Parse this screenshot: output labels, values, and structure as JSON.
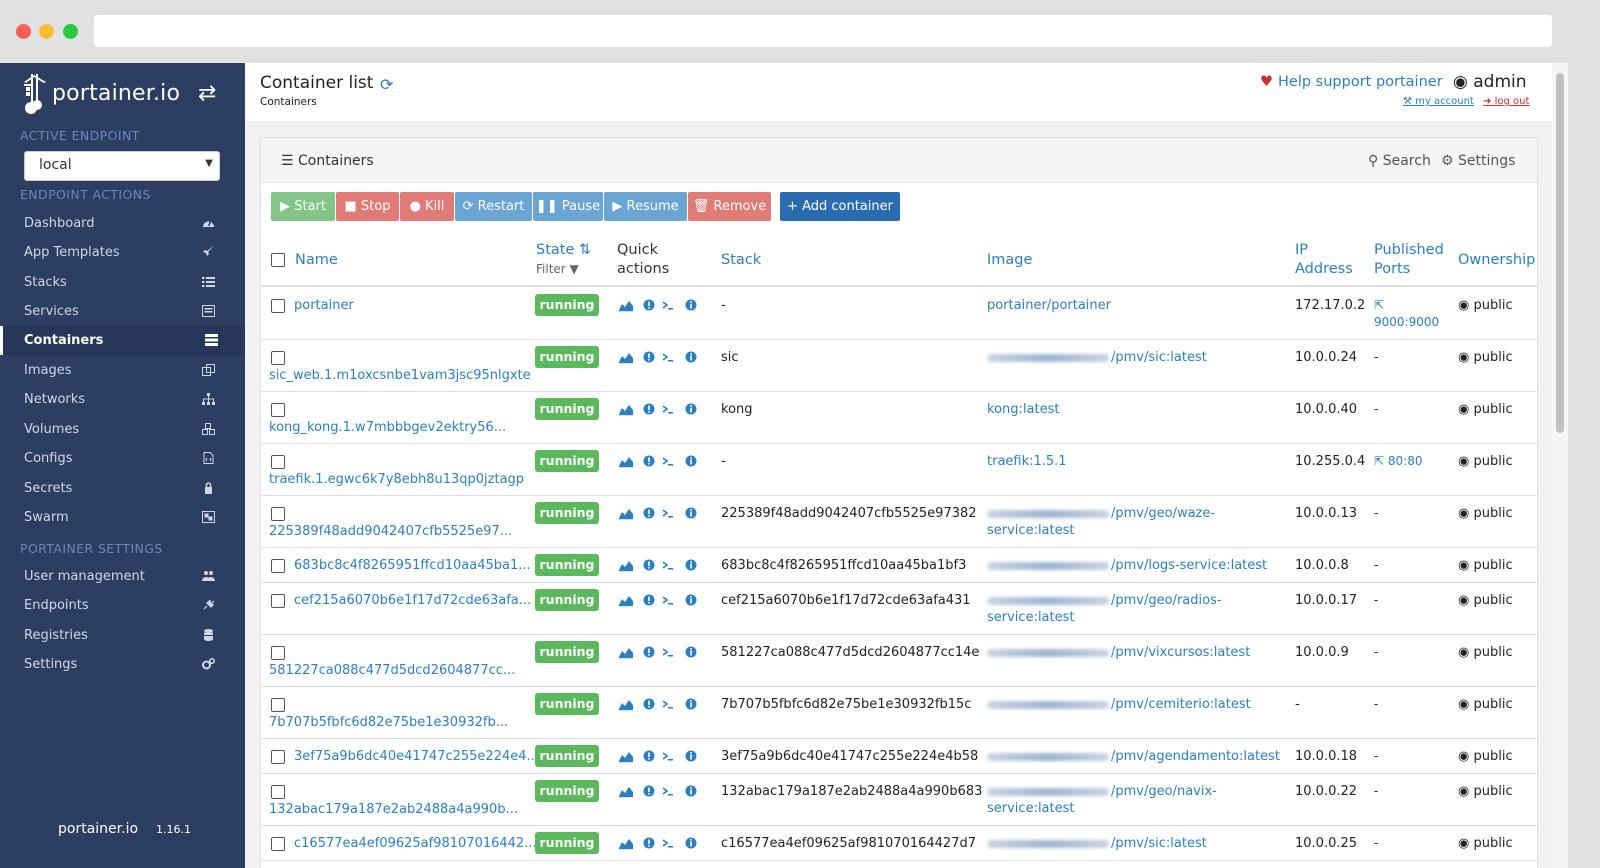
{
  "sidebar": {
    "brand": "portainer.io",
    "active_endpoint_title": "ACTIVE ENDPOINT",
    "endpoint_value": "local",
    "endpoint_actions_title": "ENDPOINT ACTIONS",
    "items": [
      {
        "label": "Dashboard",
        "icon": "tachometer-icon"
      },
      {
        "label": "App Templates",
        "icon": "rocket-icon"
      },
      {
        "label": "Stacks",
        "icon": "list-icon"
      },
      {
        "label": "Services",
        "icon": "list-alt-icon"
      },
      {
        "label": "Containers",
        "icon": "server-icon",
        "active": true
      },
      {
        "label": "Images",
        "icon": "clone-icon"
      },
      {
        "label": "Networks",
        "icon": "sitemap-icon"
      },
      {
        "label": "Volumes",
        "icon": "cubes-icon"
      },
      {
        "label": "Configs",
        "icon": "file-code-icon"
      },
      {
        "label": "Secrets",
        "icon": "lock-icon"
      },
      {
        "label": "Swarm",
        "icon": "object-group-icon"
      }
    ],
    "settings_title": "PORTAINER SETTINGS",
    "settings_items": [
      {
        "label": "User management",
        "icon": "users-icon"
      },
      {
        "label": "Endpoints",
        "icon": "plug-icon"
      },
      {
        "label": "Registries",
        "icon": "database-icon"
      },
      {
        "label": "Settings",
        "icon": "cogs-icon"
      }
    ],
    "footer_brand": "portainer.io",
    "version": "1.16.1"
  },
  "header": {
    "title": "Container list",
    "breadcrumb": "Containers",
    "support": "Help support portainer",
    "user": "admin",
    "my_account": "my account",
    "log_out": "log out"
  },
  "widget": {
    "title": "Containers",
    "search": "Search",
    "settings": "Settings"
  },
  "toolbar": {
    "start": "Start",
    "stop": "Stop",
    "kill": "Kill",
    "restart": "Restart",
    "pause": "Pause",
    "resume": "Resume",
    "remove": "Remove",
    "add": "Add container"
  },
  "columns": {
    "name": "Name",
    "state": "State",
    "filter": "Filter",
    "quick_1": "Quick",
    "quick_2": "actions",
    "stack": "Stack",
    "image": "Image",
    "ip_1": "IP",
    "ip_2": "Address",
    "ports_1": "Published",
    "ports_2": "Ports",
    "ownership": "Ownership"
  },
  "rows": [
    {
      "name": "portainer",
      "state": "running",
      "stack": "-",
      "image": "portainer/portainer",
      "ip": "172.17.0.2",
      "ports": "9000:9000",
      "owner": "public"
    },
    {
      "name": "sic_web.1.m1oxcsnbe1vam3jsc95nlgxte",
      "state": "running",
      "stack": "sic",
      "image": "/pmv/sic:latest",
      "ip": "10.0.0.24",
      "ports": "-",
      "owner": "public"
    },
    {
      "name": "kong_kong.1.w7mbbbgev2ektry56...",
      "state": "running",
      "stack": "kong",
      "image": "kong:latest",
      "ip": "10.0.0.40",
      "ports": "-",
      "owner": "public"
    },
    {
      "name": "traefik.1.egwc6k7y8ebh8u13qp0jztagp",
      "state": "running",
      "stack": "-",
      "image": "traefik:1.5.1",
      "ip": "10.255.0.4",
      "ports": "80:80",
      "owner": "public"
    },
    {
      "name": "225389f48add9042407cfb5525e97...",
      "state": "running",
      "stack": "225389f48add9042407cfb5525e97382",
      "image": "/pmv/geo/waze-",
      "image2": "service:latest",
      "ip": "10.0.0.13",
      "ports": "-",
      "owner": "public"
    },
    {
      "name": "683bc8c4f8265951ffcd10aa45ba1...",
      "state": "running",
      "stack": "683bc8c4f8265951ffcd10aa45ba1bf3",
      "image": "/pmv/logs-service:latest",
      "ip": "10.0.0.8",
      "ports": "-",
      "owner": "public"
    },
    {
      "name": "cef215a6070b6e1f17d72cde63afa...",
      "state": "running",
      "stack": "cef215a6070b6e1f17d72cde63afa431",
      "image": "/pmv/geo/radios-",
      "image2": "service:latest",
      "ip": "10.0.0.17",
      "ports": "-",
      "owner": "public"
    },
    {
      "name": "581227ca088c477d5dcd2604877cc...",
      "state": "running",
      "stack": "581227ca088c477d5dcd2604877cc14e",
      "image": "/pmv/vixcursos:latest",
      "ip": "10.0.0.9",
      "ports": "-",
      "owner": "public"
    },
    {
      "name": "7b707b5fbfc6d82e75be1e30932fb...",
      "state": "running",
      "stack": "7b707b5fbfc6d82e75be1e30932fb15c",
      "image": "/pmv/cemiterio:latest",
      "ip": "-",
      "ports": "-",
      "owner": "public"
    },
    {
      "name": "3ef75a9b6dc40e41747c255e224e4...",
      "state": "running",
      "stack": "3ef75a9b6dc40e41747c255e224e4b58",
      "image": "/pmv/agendamento:latest",
      "ip": "10.0.0.18",
      "ports": "-",
      "owner": "public"
    },
    {
      "name": "132abac179a187e2ab2488a4a990b...",
      "state": "running",
      "stack": "132abac179a187e2ab2488a4a990b683",
      "image": "/pmv/geo/navix-",
      "image2": "service:latest",
      "ip": "10.0.0.22",
      "ports": "-",
      "owner": "public"
    },
    {
      "name": "c16577ea4ef09625af98107016442...",
      "state": "running",
      "stack": "c16577ea4ef09625af981070164427d7",
      "image": "/pmv/sic:latest",
      "ip": "10.0.0.25",
      "ports": "-",
      "owner": "public"
    }
  ]
}
